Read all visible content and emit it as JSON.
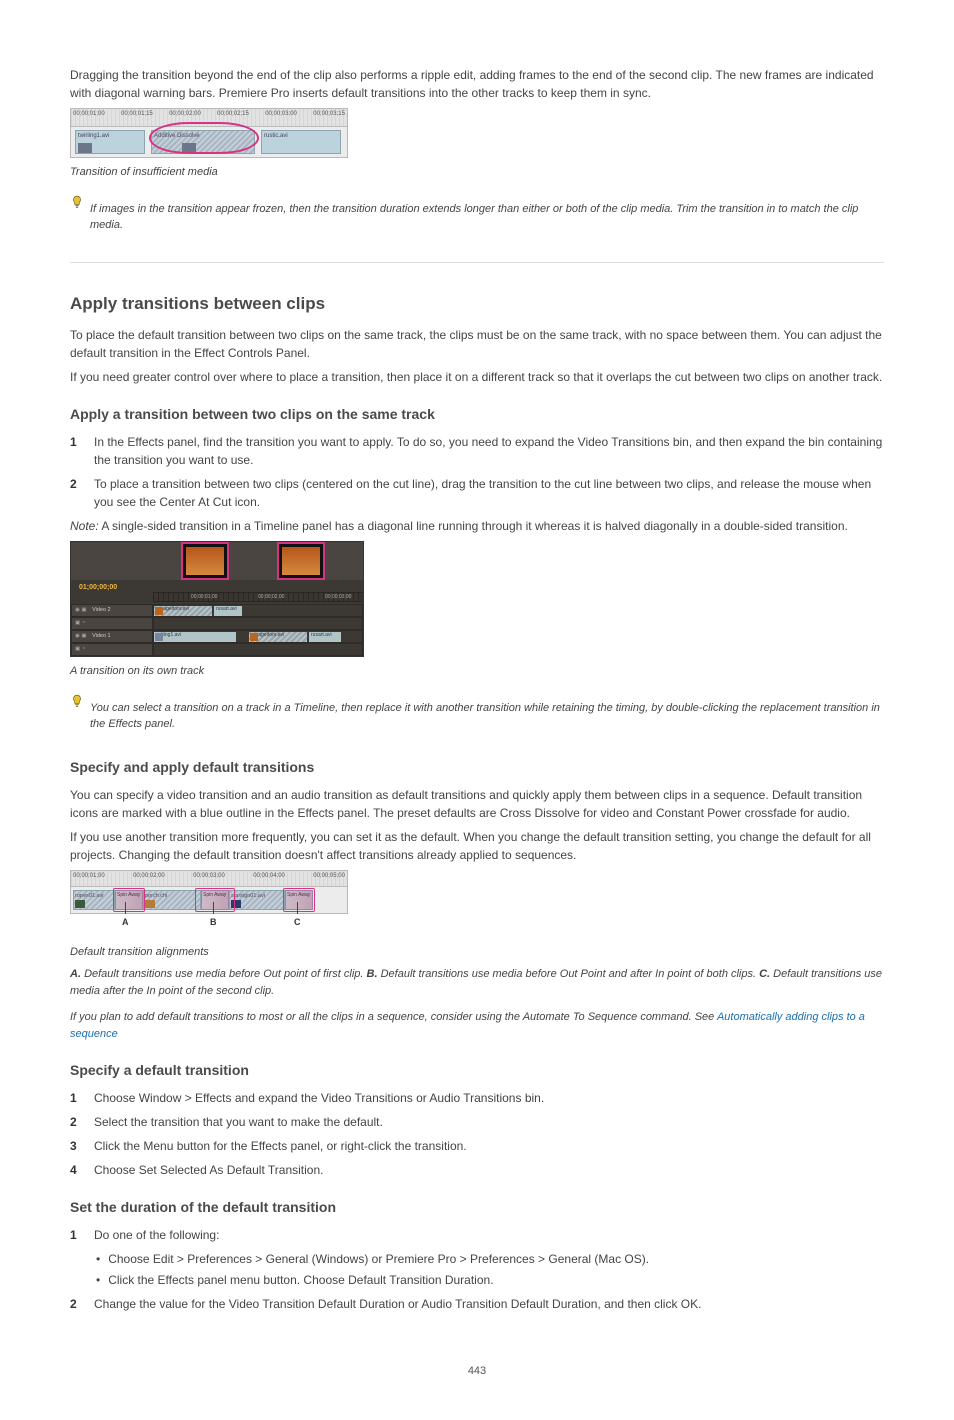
{
  "page_number": "443",
  "intro": {
    "p1": "Dragging the transition beyond the end of the clip also performs a ripple edit, adding frames to the end of the second clip. The new frames are indicated with diagonal warning bars. Premiere Pro inserts default transitions into the other tracks to keep them in sync."
  },
  "figure1": {
    "ruler_labels": [
      "00;00;01;00",
      "00;00;01;15",
      "00;00;02;00",
      "00;00;02;15",
      "00;00;03;00",
      "00;00;03;15"
    ],
    "clip_left": "twirling1.avi",
    "clip_mid": "Additive Dissolve",
    "clip_right": "rustic.avi",
    "caption": "Transition of insufficient media"
  },
  "tip1": "If images in the transition appear frozen, then the transition duration extends longer than either or both of the clip media. Trim the transition in to match the clip media.",
  "section2": {
    "title": "Apply transitions between clips",
    "p1": "To place the default transition between two clips on the same track, the clips must be on the same track, with no space between them. You can adjust the default transition in the Effect Controls Panel.",
    "p2": "If you need greater control over where to place a transition, then place it on a different track so that it overlaps the cut between two clips on another track.",
    "sub_apply": "Apply a transition between two clips on the same track",
    "step1_label": "1",
    "step1": "In the Effects panel, find the transition you want to apply. To do so, you need to expand the Video Transitions bin, and then expand the bin containing the transition you want to use.",
    "step2_label": "2",
    "step2": "To place a transition between two clips (centered on the cut line), drag the transition to the cut line between two clips, and release the mouse when you see the Center At Cut icon."
  },
  "figure2": {
    "timecode": "01;00;00;00",
    "ticks": [
      "00;00;01;00",
      "00;00;02;00",
      "00;00;03;00"
    ],
    "track_v2": "Video 2",
    "track_v1": "Video 1",
    "clip_v2_left": "garagedoor.avi",
    "clip_v2_right": "rusart.avi",
    "clip_v1_left": "writing1.avi",
    "clip_v1_right_a": "garagedoor.avi",
    "clip_v1_right_b": "rusart.avi",
    "caption": "A transition on its own track"
  },
  "tip2": "You can select a transition on a track in a Timeline, then replace it with another transition while retaining the timing, by double-clicking the replacement transition in the Effects panel.",
  "section3": {
    "title": "Specify and apply default transitions",
    "p1": "You can specify a video transition and an audio transition as default transitions and quickly apply them between clips in a sequence. Default transition icons are marked with a blue outline in the Effects panel. The preset defaults are Cross Dissolve for video and Constant Power crossfade for audio.",
    "p2": "If you use another transition more frequently, you can set it as the default. When you change the default transition setting, you change the default for all projects. Changing the default transition doesn't affect transitions already applied to sequences."
  },
  "figure3": {
    "ruler_labels": [
      "00;00;01;00",
      "00;00;02;00",
      "00;00;03;00",
      "00;00;04;00",
      "00;00;05;00"
    ],
    "clip1": "ropes01.avi",
    "t1": "Spin Away",
    "clip2": "porch.chi",
    "t2": "Spin Away",
    "clip3": "starsign01.avi",
    "t3": "Spin Away",
    "callout_a": "A",
    "callout_b": "B",
    "callout_c": "C",
    "caption": "Default transition alignments",
    "legend": [
      "A. ",
      "Default transitions use media before Out point of first clip. ",
      "B. ",
      "Default transitions use media before Out Point and after In point of both clips. ",
      "C. ",
      "Default transitions use media after the In point of the second clip."
    ]
  },
  "tip3": "If you plan to add default transitions to most or all the clips in a sequence, consider using the Automate To Sequence command. See",
  "link_label": "Automatically adding clips to a sequence",
  "section4": {
    "title": "Specify a default transition",
    "step1_label": "1",
    "step1": "Choose Window > Effects and expand the Video Transitions or Audio Transitions bin.",
    "step2_label": "2",
    "step2": "Select the transition that you want to make the default.",
    "step3_label": "3",
    "step3": "Click the Menu button for the Effects panel, or right-click the transition.",
    "step4_label": "4",
    "step4": "Choose Set Selected As Default Transition."
  },
  "section5": {
    "title": "Set the duration of the default transition",
    "step1_label": "1",
    "step1": "Do one of the following:",
    "step1a_bullet": "•",
    "step1a": "Choose Edit > Preferences > General (Windows) or Premiere Pro > Preferences > General (Mac OS).",
    "step1b_bullet": "•",
    "step1b": "Click the Effects panel menu button. Choose Default Transition Duration.",
    "step2_label": "2",
    "step2": "Change the value for the Video Transition Default Duration or Audio Transition Default Duration, and then click OK."
  },
  "note_label": "Note:",
  "note_text": "A single-sided transition in a Timeline panel has a diagonal line running through it whereas it is halved diagonally in a double-sided transition."
}
